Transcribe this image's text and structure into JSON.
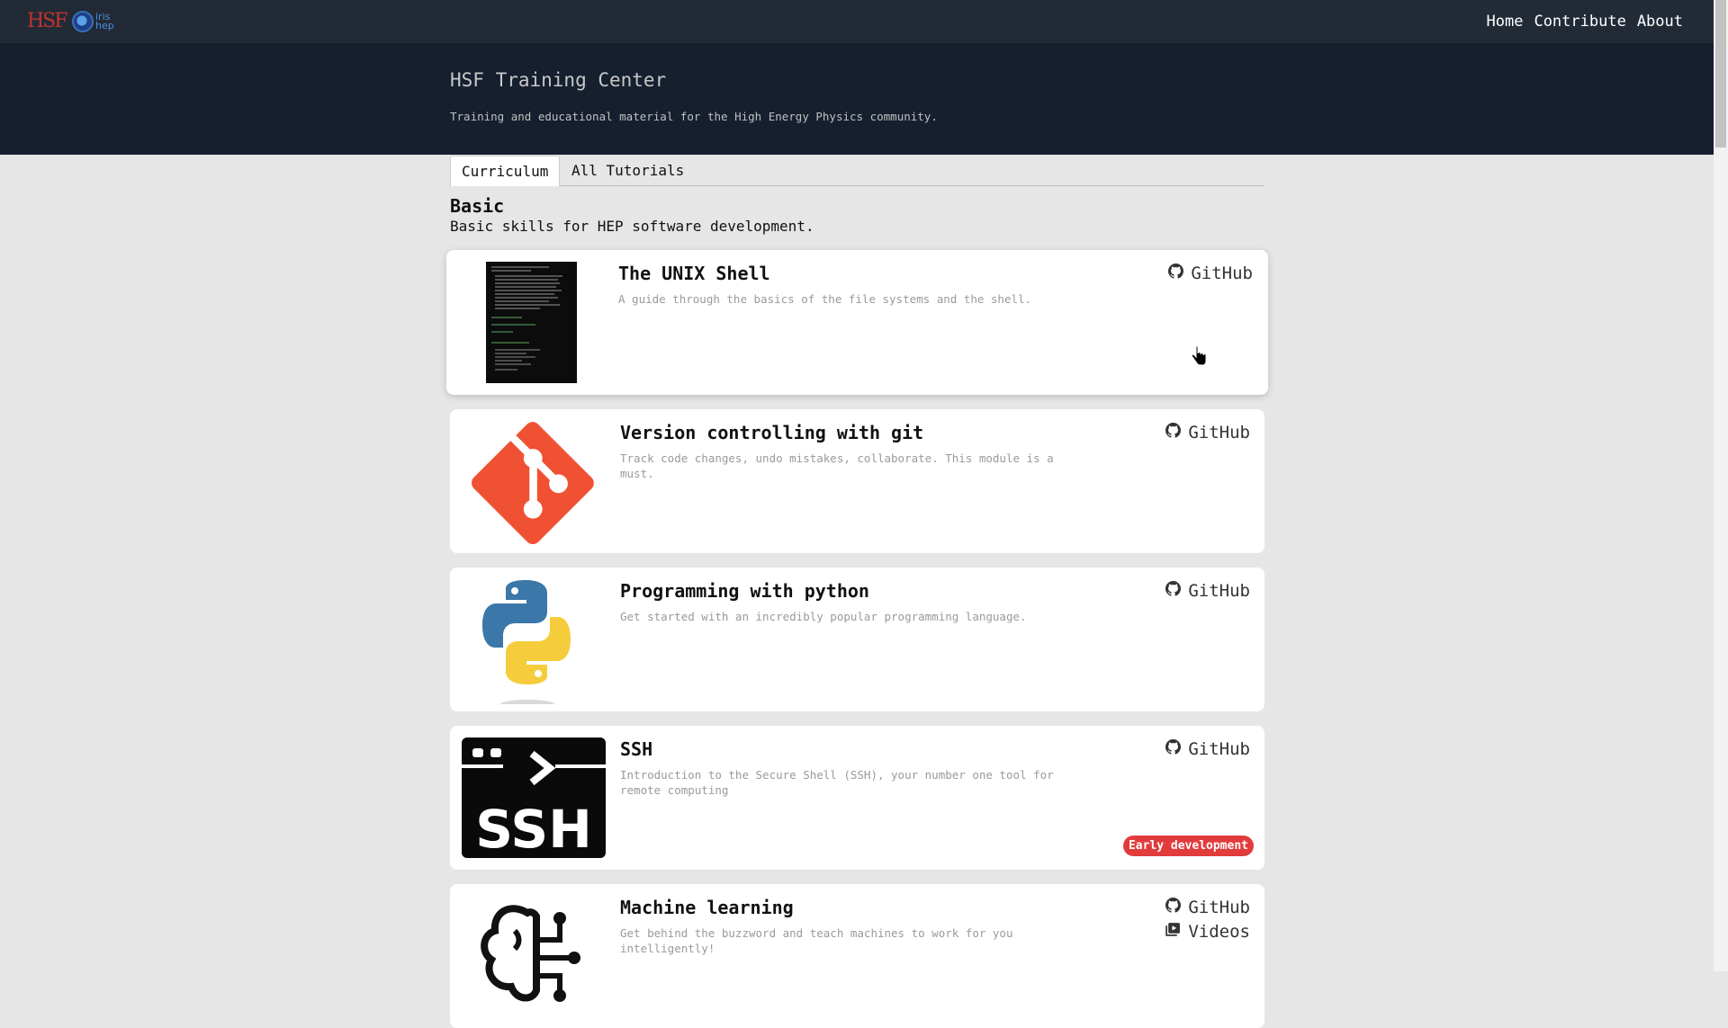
{
  "nav": {
    "logo_hsf": "HSF",
    "logo_iris": "iris hep",
    "links": [
      "Home",
      "Contribute",
      "About"
    ]
  },
  "hero": {
    "title": "HSF Training Center",
    "subtitle": "Training and educational material for the High Energy Physics community."
  },
  "tabs": [
    "Curriculum",
    "All Tutorials"
  ],
  "section": {
    "title": "Basic",
    "description": "Basic skills for HEP software development."
  },
  "cards": [
    {
      "title": "The UNIX Shell",
      "description": "A guide through the basics of the file systems and the shell.",
      "links": [
        "GitHub"
      ]
    },
    {
      "title": "Version controlling with git",
      "description": "Track code changes, undo mistakes, collaborate. This module is a must.",
      "links": [
        "GitHub"
      ]
    },
    {
      "title": "Programming with python",
      "description": "Get started with an incredibly popular programming language.",
      "links": [
        "GitHub"
      ]
    },
    {
      "title": "SSH",
      "description": "Introduction to the Secure Shell (SSH), your number one tool for remote computing",
      "links": [
        "GitHub"
      ],
      "badge": "Early development"
    },
    {
      "title": "Machine learning",
      "description": "Get behind the buzzword and teach machines to work for you intelligently!",
      "links": [
        "GitHub",
        "Videos"
      ]
    }
  ],
  "colors": {
    "navbar": "#222a36",
    "hero": "#161f2e",
    "badge": "#e23b3b",
    "git": "#f05133"
  },
  "icons": [
    "github-icon",
    "video-icon",
    "terminal-thumbnail",
    "git-logo",
    "python-logo",
    "ssh-logo",
    "brain-circuit-logo"
  ]
}
